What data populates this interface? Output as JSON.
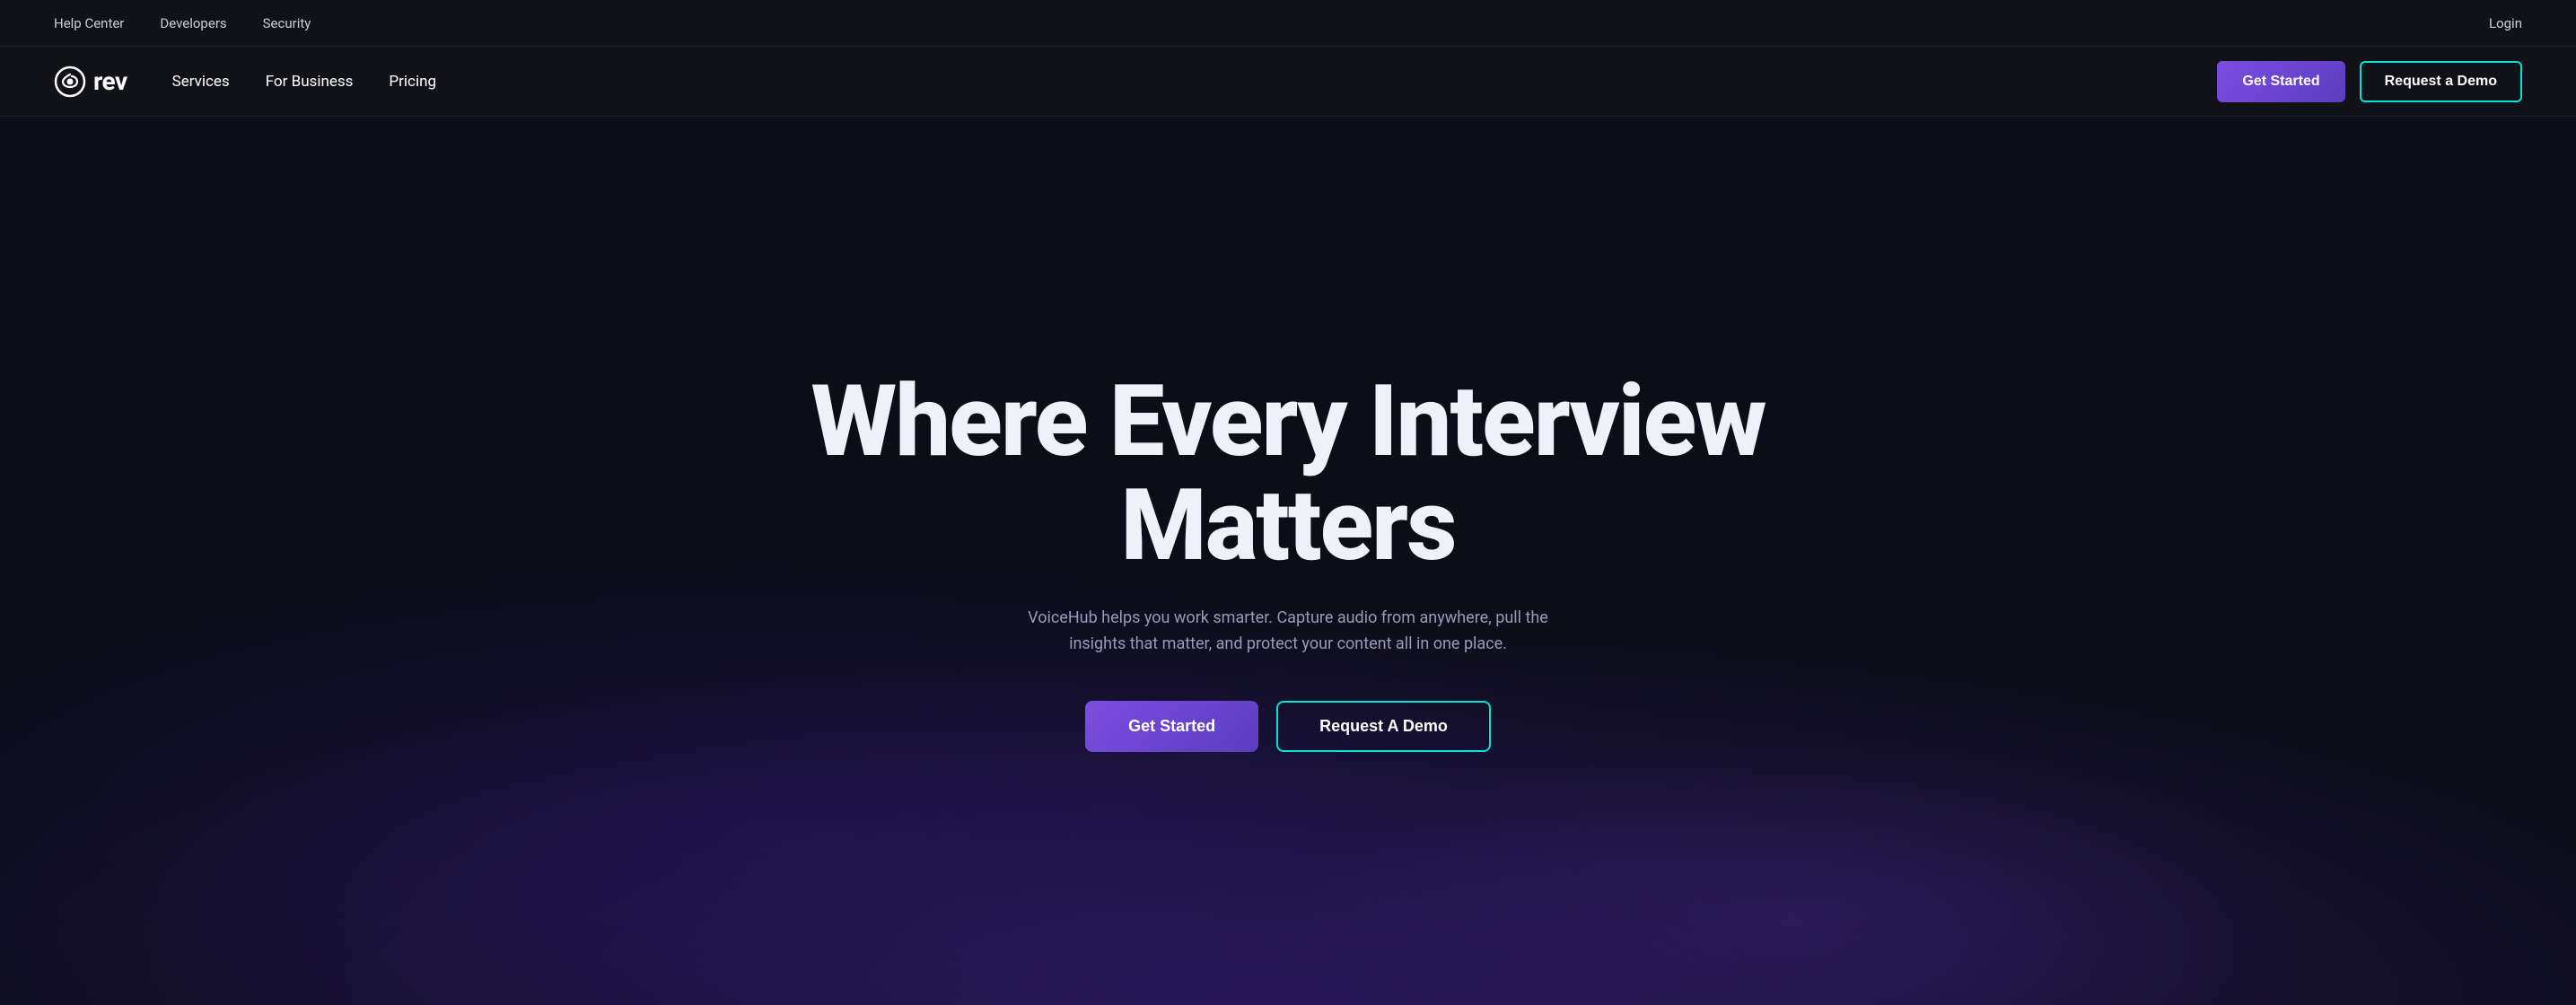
{
  "topBar": {
    "links": [
      {
        "label": "Help Center",
        "name": "help-center-link"
      },
      {
        "label": "Developers",
        "name": "developers-link"
      },
      {
        "label": "Security",
        "name": "security-link"
      }
    ],
    "loginLabel": "Login"
  },
  "mainNav": {
    "logo": {
      "text": "rev",
      "ariaLabel": "Rev logo"
    },
    "links": [
      {
        "label": "Services",
        "name": "services-nav-link"
      },
      {
        "label": "For Business",
        "name": "for-business-nav-link"
      },
      {
        "label": "Pricing",
        "name": "pricing-nav-link"
      }
    ],
    "getStartedLabel": "Get Started",
    "requestDemoLabel": "Request a Demo"
  },
  "hero": {
    "title": "Where Every Interview Matters",
    "subtitle": "VoiceHub helps you work smarter. Capture audio from anywhere, pull the insights that matter, and protect your content all in one place.",
    "getStartedLabel": "Get Started",
    "requestDemoLabel": "Request A Demo"
  },
  "colors": {
    "accent_purple": "#7b4de0",
    "accent_teal": "#00e5d4",
    "bg_dark": "#0d0d1a",
    "bg_nav": "#111118"
  }
}
